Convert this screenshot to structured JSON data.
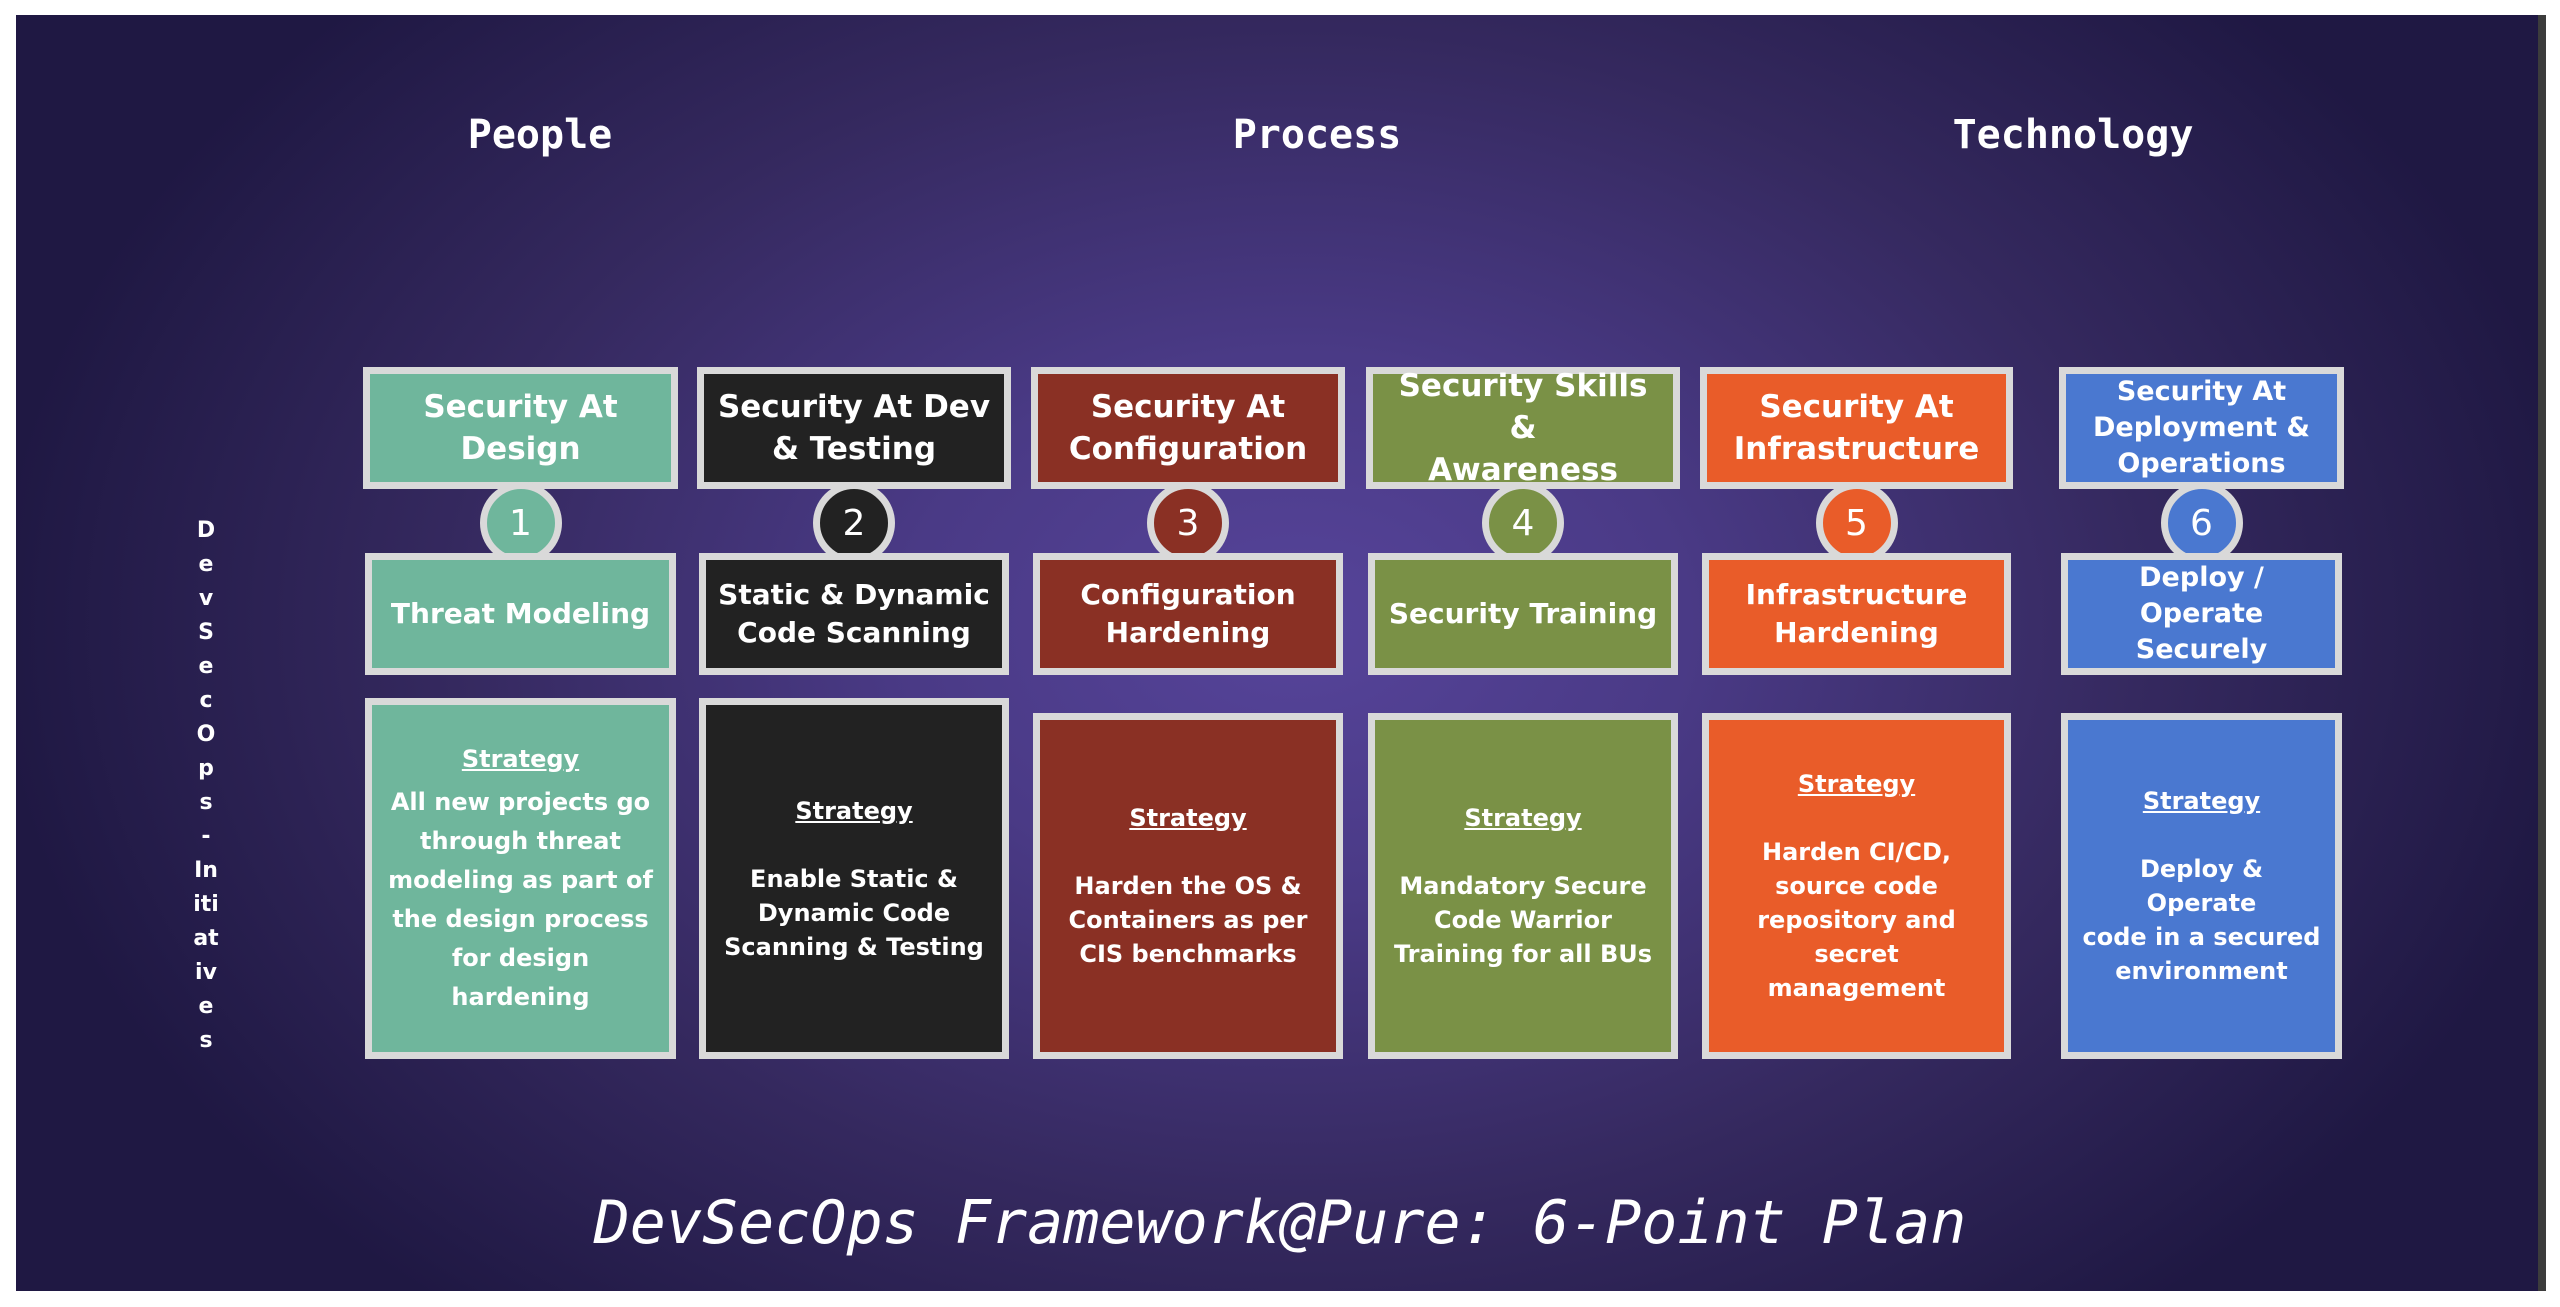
{
  "pillars": [
    "People",
    "Process",
    "Technology"
  ],
  "vertical_label": [
    "D",
    "e",
    "v",
    "S",
    "e",
    "c",
    "O",
    "p",
    "s",
    "-",
    "In",
    "iti",
    "at",
    "iv",
    "e",
    "s"
  ],
  "title": "DevSecOps Framework@Pure: 6-Point Plan",
  "colors": {
    "card1": "#6fb69c",
    "card2": "#222222",
    "card3": "#8a3024",
    "card4": "#7a9146",
    "card5": "#e95c29",
    "card6": "#4a78d0",
    "border": "#d9d9d9"
  },
  "cards": [
    {
      "number": "1",
      "header": [
        "Security At",
        "Design"
      ],
      "initiative": [
        "Threat Modeling"
      ],
      "strategy_label": "Strategy",
      "strategy": [
        "All new projects go",
        "through threat",
        "modeling as part of",
        "the design process",
        "for  design",
        "hardening"
      ]
    },
    {
      "number": "2",
      "header": [
        "Security At Dev",
        "& Testing"
      ],
      "initiative": [
        "Static & Dynamic",
        "Code Scanning"
      ],
      "strategy_label": "Strategy",
      "strategy": [
        "Enable Static &",
        "Dynamic Code",
        "Scanning & Testing"
      ]
    },
    {
      "number": "3",
      "header": [
        "Security At",
        "Configuration"
      ],
      "initiative": [
        "Configuration",
        "Hardening"
      ],
      "strategy_label": "Strategy",
      "strategy": [
        "Harden the OS &",
        "Containers as per",
        "CIS benchmarks"
      ]
    },
    {
      "number": "4",
      "header": [
        "Security Skills &",
        "Awareness"
      ],
      "initiative": [
        "Security Training"
      ],
      "strategy_label": "Strategy",
      "strategy": [
        "Mandatory Secure",
        "Code Warrior",
        "Training for all BUs"
      ]
    },
    {
      "number": "5",
      "header": [
        "Security At",
        "Infrastructure"
      ],
      "initiative": [
        "Infrastructure",
        "Hardening"
      ],
      "strategy_label": "Strategy",
      "strategy": [
        "Harden CI/CD,",
        "source code",
        "repository and",
        "secret management"
      ]
    },
    {
      "number": "6",
      "header": [
        "Security At",
        "Deployment &",
        "Operations"
      ],
      "initiative": [
        "Deploy /",
        "Operate",
        "Securely"
      ],
      "strategy_label": "Strategy",
      "strategy": [
        "Deploy & Operate",
        "code in a secured",
        "environment"
      ]
    }
  ]
}
